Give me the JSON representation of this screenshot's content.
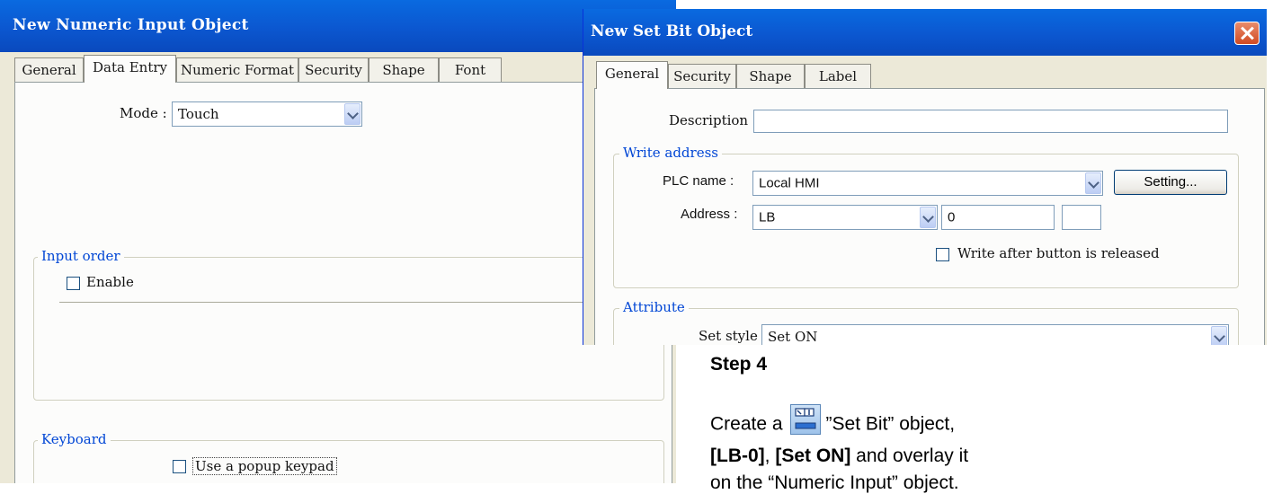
{
  "numeric_dialog": {
    "title": "New  Numeric Input Object",
    "tabs": [
      "General",
      "Data Entry",
      "Numeric Format",
      "Security",
      "Shape",
      "Font"
    ],
    "active_tab": "Data Entry",
    "mode_label": "Mode :",
    "mode_value": "Touch",
    "input_order": {
      "group_label": "Input order",
      "enable_label": "Enable",
      "enable_checked": false
    },
    "keyboard": {
      "group_label": "Keyboard",
      "popup_label": "Use a popup keypad",
      "popup_checked": false
    }
  },
  "setbit_dialog": {
    "title": "New  Set Bit Object",
    "tabs": [
      "General",
      "Security",
      "Shape",
      "Label"
    ],
    "active_tab": "General",
    "description_label": "Description :",
    "description_value": "",
    "write_address": {
      "group_label": "Write address",
      "plc_name_label": "PLC name :",
      "plc_name_value": "Local HMI",
      "setting_button": "Setting...",
      "address_label": "Address :",
      "address_device": "LB",
      "address_value": "0",
      "write_after_label": "Write after button is released",
      "write_after_checked": false
    },
    "attribute": {
      "group_label": "Attribute",
      "set_style_label": "Set style :",
      "set_style_value": "Set ON"
    }
  },
  "step": {
    "title": "Step 4",
    "line1_before": "Create a",
    "line1_after": "”Set Bit” object,",
    "line2_part1": "[LB-0]",
    "line2_part2": ",",
    "line2_part3": "[Set ON]",
    "line2_part4": " and overlay it",
    "line3": "on the “Numeric Input” object."
  },
  "colors": {
    "titlebar": "#0b57d0",
    "dialog_bg": "#ece9d8",
    "group_label": "#0046d5"
  }
}
